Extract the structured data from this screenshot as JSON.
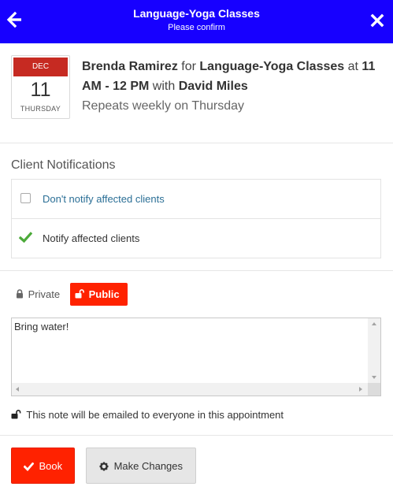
{
  "header": {
    "title": "Language-Yoga Classes",
    "subtitle": "Please confirm",
    "back_icon": "arrow-left-icon",
    "close_icon": "close-icon",
    "background": "#1700ff"
  },
  "appointment": {
    "date": {
      "month": "DEC",
      "day": "11",
      "weekday": "THURSDAY",
      "accent": "#c62a22"
    },
    "client": "Brenda Ramirez",
    "for_word": "for",
    "class_name": "Language-Yoga Classes",
    "at_word": "at",
    "time": "11 AM - 12 PM",
    "with_word": "with",
    "instructor": "David Miles",
    "repeat": "Repeats weekly on Thursday"
  },
  "notifications": {
    "title": "Client Notifications",
    "options": [
      {
        "label": "Don't notify affected clients",
        "selected": false
      },
      {
        "label": "Notify affected clients",
        "selected": true,
        "icon": "checkmark-icon",
        "color": "#4caa3a"
      }
    ]
  },
  "privacy": {
    "private_label": "Private",
    "public_label": "Public",
    "selected": "Public",
    "accent": "#ff2200"
  },
  "note": {
    "value": "Bring water!",
    "hint": "This note will be emailed to everyone in this appointment"
  },
  "actions": {
    "book_label": "Book",
    "changes_label": "Make Changes"
  }
}
